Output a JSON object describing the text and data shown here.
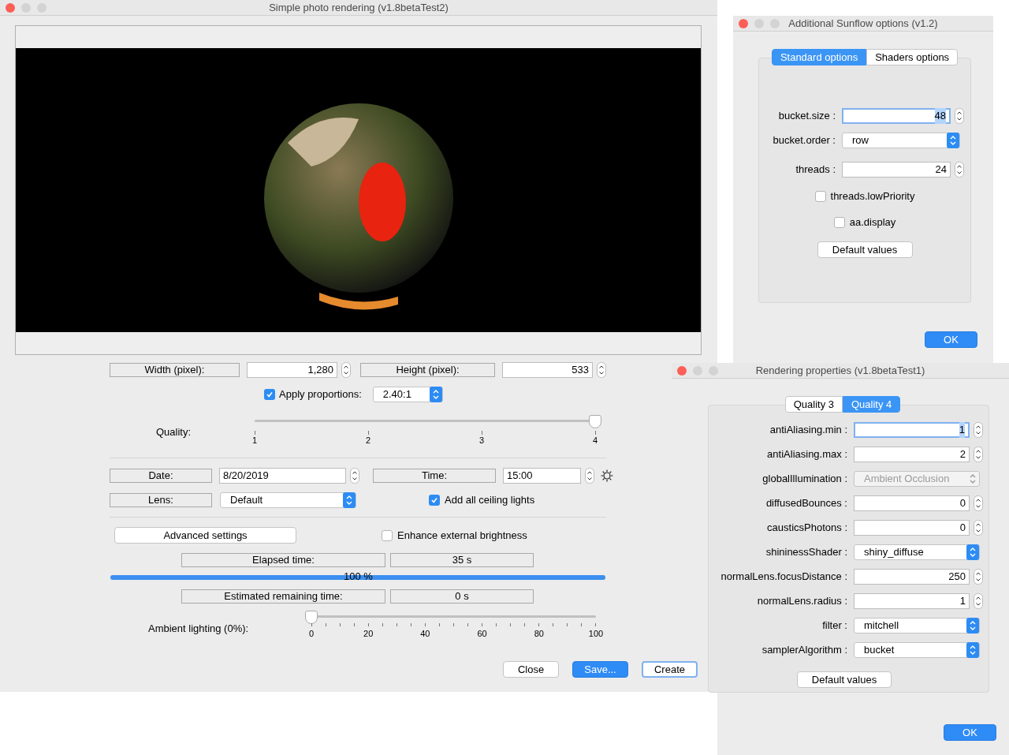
{
  "main_window": {
    "title": "Simple photo rendering (v1.8betaTest2)",
    "width": {
      "label": "Width (pixel):",
      "value": "1,280"
    },
    "height": {
      "label": "Height (pixel):",
      "value": "533"
    },
    "apply_proportions": {
      "label": "Apply proportions:",
      "checked": true,
      "ratio": "2.40:1"
    },
    "quality": {
      "label": "Quality:",
      "level": 1,
      "ticks": [
        "1",
        "2",
        "3",
        "4"
      ]
    },
    "date": {
      "label": "Date:",
      "value": "8/20/2019"
    },
    "time": {
      "label": "Time:",
      "value": "15:00"
    },
    "lens": {
      "label": "Lens:",
      "value": "Default"
    },
    "ceiling_lights": {
      "label": "Add all ceiling lights",
      "checked": true
    },
    "advanced_button": "Advanced settings",
    "enhance_brightness": {
      "label": "Enhance external brightness",
      "checked": false
    },
    "elapsed": {
      "label": "Elapsed time:",
      "value": "35 s"
    },
    "progress": {
      "level": 1,
      "text": "100 %"
    },
    "remaining": {
      "label": "Estimated remaining time:",
      "value": "0 s"
    },
    "ambient": {
      "label": "Ambient lighting (0%):",
      "level": 0,
      "ticks": [
        "0",
        "20",
        "40",
        "60",
        "80",
        "100"
      ]
    },
    "buttons": [
      {
        "label": "Close",
        "kind": "plain"
      },
      {
        "label": "Save...",
        "kind": "default"
      },
      {
        "label": "Create",
        "kind": "focused"
      }
    ]
  },
  "sunflow_window": {
    "title": "Additional Sunflow options (v1.2)",
    "tabs": [
      {
        "label": "Standard options",
        "selected": true
      },
      {
        "label": "Shaders options",
        "selected": false
      }
    ],
    "rows": [
      {
        "kind": "spinner",
        "label": "bucket.size :",
        "value": "48",
        "focused": true
      },
      {
        "kind": "combo",
        "label": "bucket.order :",
        "value": "row",
        "disabled": false
      },
      {
        "kind": "spinner",
        "label": "threads :",
        "value": "24",
        "focused": false
      }
    ],
    "checkboxes": [
      {
        "label": "threads.lowPriority",
        "checked": false
      },
      {
        "label": "aa.display",
        "checked": false
      }
    ],
    "default_button": "Default values",
    "ok_button": "OK"
  },
  "rendering_window": {
    "title": "Rendering properties (v1.8betaTest1)",
    "tabs": [
      {
        "label": "Quality 3",
        "selected": false
      },
      {
        "label": "Quality 4",
        "selected": true
      }
    ],
    "rows": [
      {
        "kind": "spinner",
        "label": "antiAliasing.min :",
        "value": "1",
        "focused": true
      },
      {
        "kind": "spinner",
        "label": "antiAliasing.max :",
        "value": "2",
        "focused": false
      },
      {
        "kind": "combo",
        "label": "globalIllumination :",
        "value": "Ambient Occlusion",
        "disabled": true
      },
      {
        "kind": "spinner",
        "label": "diffusedBounces :",
        "value": "0",
        "focused": false
      },
      {
        "kind": "spinner",
        "label": "causticsPhotons :",
        "value": "0",
        "focused": false
      },
      {
        "kind": "combo",
        "label": "shininessShader :",
        "value": "shiny_diffuse",
        "disabled": false
      },
      {
        "kind": "spinner",
        "label": "normalLens.focusDistance :",
        "value": "250",
        "focused": false
      },
      {
        "kind": "spinner",
        "label": "normalLens.radius :",
        "value": "1",
        "focused": false
      },
      {
        "kind": "combo",
        "label": "filter :",
        "value": "mitchell",
        "disabled": false
      },
      {
        "kind": "combo",
        "label": "samplerAlgorithm :",
        "value": "bucket",
        "disabled": false
      }
    ],
    "default_button": "Default values",
    "ok_button": "OK"
  }
}
